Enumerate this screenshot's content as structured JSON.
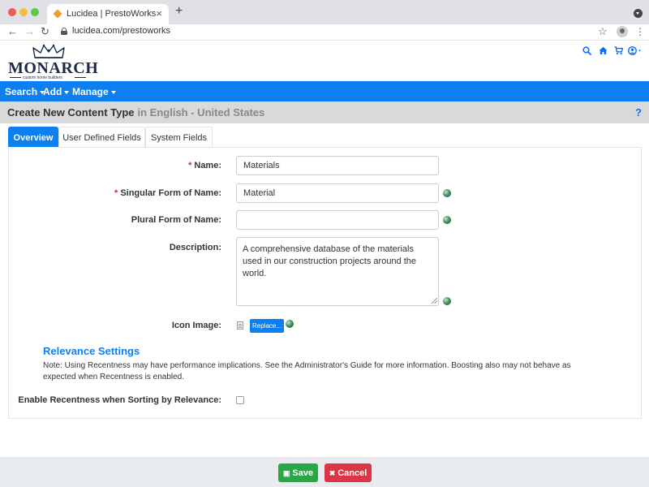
{
  "browser": {
    "tab_title": "Lucidea | PrestoWorks",
    "url": "lucidea.com/prestoworks",
    "icons": [
      "back-arrow-icon",
      "forward-arrow-icon",
      "reload-icon",
      "lock-icon",
      "star-icon",
      "profile-icon",
      "kebab-menu-icon"
    ]
  },
  "logo": {
    "name": "MONARCH",
    "tagline": "custom home builders"
  },
  "header_icons": [
    "search-icon",
    "home-icon",
    "cart-icon",
    "user-icon"
  ],
  "navbar": {
    "items": [
      {
        "label": "Search"
      },
      {
        "label": "Add"
      },
      {
        "label": "Manage"
      }
    ]
  },
  "page": {
    "title": "Create New Content Type",
    "subtitle": "in English - United States",
    "help": "?"
  },
  "tabs": [
    {
      "label": "Overview",
      "active": true
    },
    {
      "label": "User Defined Fields",
      "active": false
    },
    {
      "label": "System Fields",
      "active": false
    }
  ],
  "form": {
    "name_label": "Name:",
    "name_value": "Materials",
    "singular_label": "Singular Form of Name:",
    "singular_value": "Material",
    "plural_label": "Plural Form of Name:",
    "plural_value": "",
    "description_label": "Description:",
    "description_value": "A comprehensive database of the materials used in our construction projects around the world.",
    "icon_label": "Icon Image:",
    "replace_label": "Replace..."
  },
  "relevance": {
    "heading": "Relevance Settings",
    "note": "Note: Using Recentness may have performance implications. See the Administrator's Guide for more information. Boosting also may not behave as expected when Recentness is enabled.",
    "recentness_label": "Enable Recentness when Sorting by Relevance:",
    "recentness_checked": false
  },
  "footer": {
    "save_label": "Save",
    "cancel_label": "Cancel"
  },
  "colors": {
    "brand_blue": "#0d7ff0",
    "save_green": "#28a745",
    "cancel_red": "#dc3545",
    "required_red": "#d12b2b",
    "logo_navy": "#1b2a4a"
  }
}
